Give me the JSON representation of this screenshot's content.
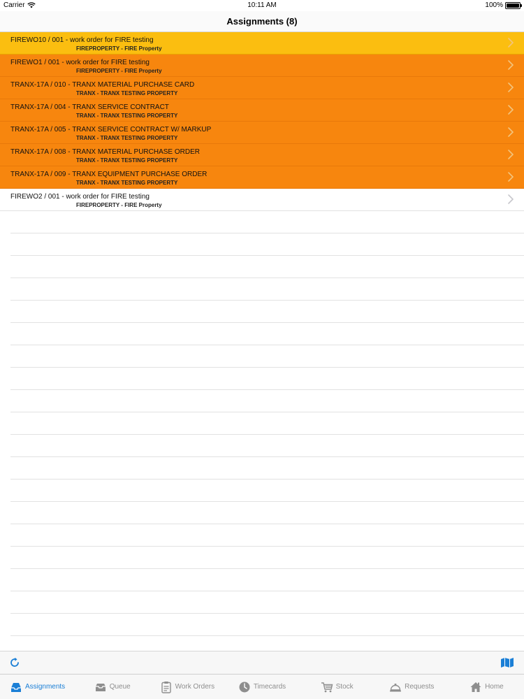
{
  "status_bar": {
    "carrier": "Carrier",
    "time": "10:11 AM",
    "battery_label": "100%",
    "battery_level": 1.0
  },
  "nav": {
    "title": "Assignments (8)"
  },
  "assignments": [
    {
      "title": "FIREWO10 / 001 - work order for FIRE testing",
      "subtitle": "FIREPROPERTY - FIRE Property",
      "state": "selected"
    },
    {
      "title": "FIREWO1 / 001 - work order for FIRE testing",
      "subtitle": "FIREPROPERTY - FIRE Property",
      "state": "highlight"
    },
    {
      "title": "TRANX-17A / 010 - TRANX MATERIAL PURCHASE CARD",
      "subtitle": "TRANX - TRANX TESTING PROPERTY",
      "state": "highlight"
    },
    {
      "title": "TRANX-17A / 004 - TRANX SERVICE CONTRACT",
      "subtitle": "TRANX - TRANX TESTING PROPERTY",
      "state": "highlight"
    },
    {
      "title": "TRANX-17A / 005 - TRANX SERVICE CONTRACT W/ MARKUP",
      "subtitle": "TRANX - TRANX TESTING PROPERTY",
      "state": "highlight"
    },
    {
      "title": "TRANX-17A / 008 - TRANX MATERIAL PURCHASE ORDER",
      "subtitle": "TRANX - TRANX TESTING PROPERTY",
      "state": "highlight"
    },
    {
      "title": "TRANX-17A / 009 - TRANX EQUIPMENT PURCHASE ORDER",
      "subtitle": "TRANX - TRANX TESTING PROPERTY",
      "state": "highlight"
    },
    {
      "title": "FIREWO2 / 001 - work order for FIRE testing",
      "subtitle": "FIREPROPERTY - FIRE Property",
      "state": "normal"
    }
  ],
  "toolbar": {
    "left_icon": "refresh-icon",
    "right_icon": "map-icon"
  },
  "tabs": [
    {
      "label": "Assignments",
      "icon": "inbox-icon",
      "active": true
    },
    {
      "label": "Queue",
      "icon": "tray-icon",
      "active": false
    },
    {
      "label": "Work Orders",
      "icon": "clipboard-icon",
      "active": false
    },
    {
      "label": "Timecards",
      "icon": "clock-icon",
      "active": false
    },
    {
      "label": "Stock",
      "icon": "cart-icon",
      "active": false
    },
    {
      "label": "Requests",
      "icon": "service-bell-icon",
      "active": false
    },
    {
      "label": "Home",
      "icon": "house-icon",
      "active": false
    }
  ],
  "colors": {
    "selected_row": "#fbbe10",
    "highlight_row": "#f7860e",
    "active_tab": "#1b7fd6",
    "inactive_tab": "#8e8e8e"
  }
}
